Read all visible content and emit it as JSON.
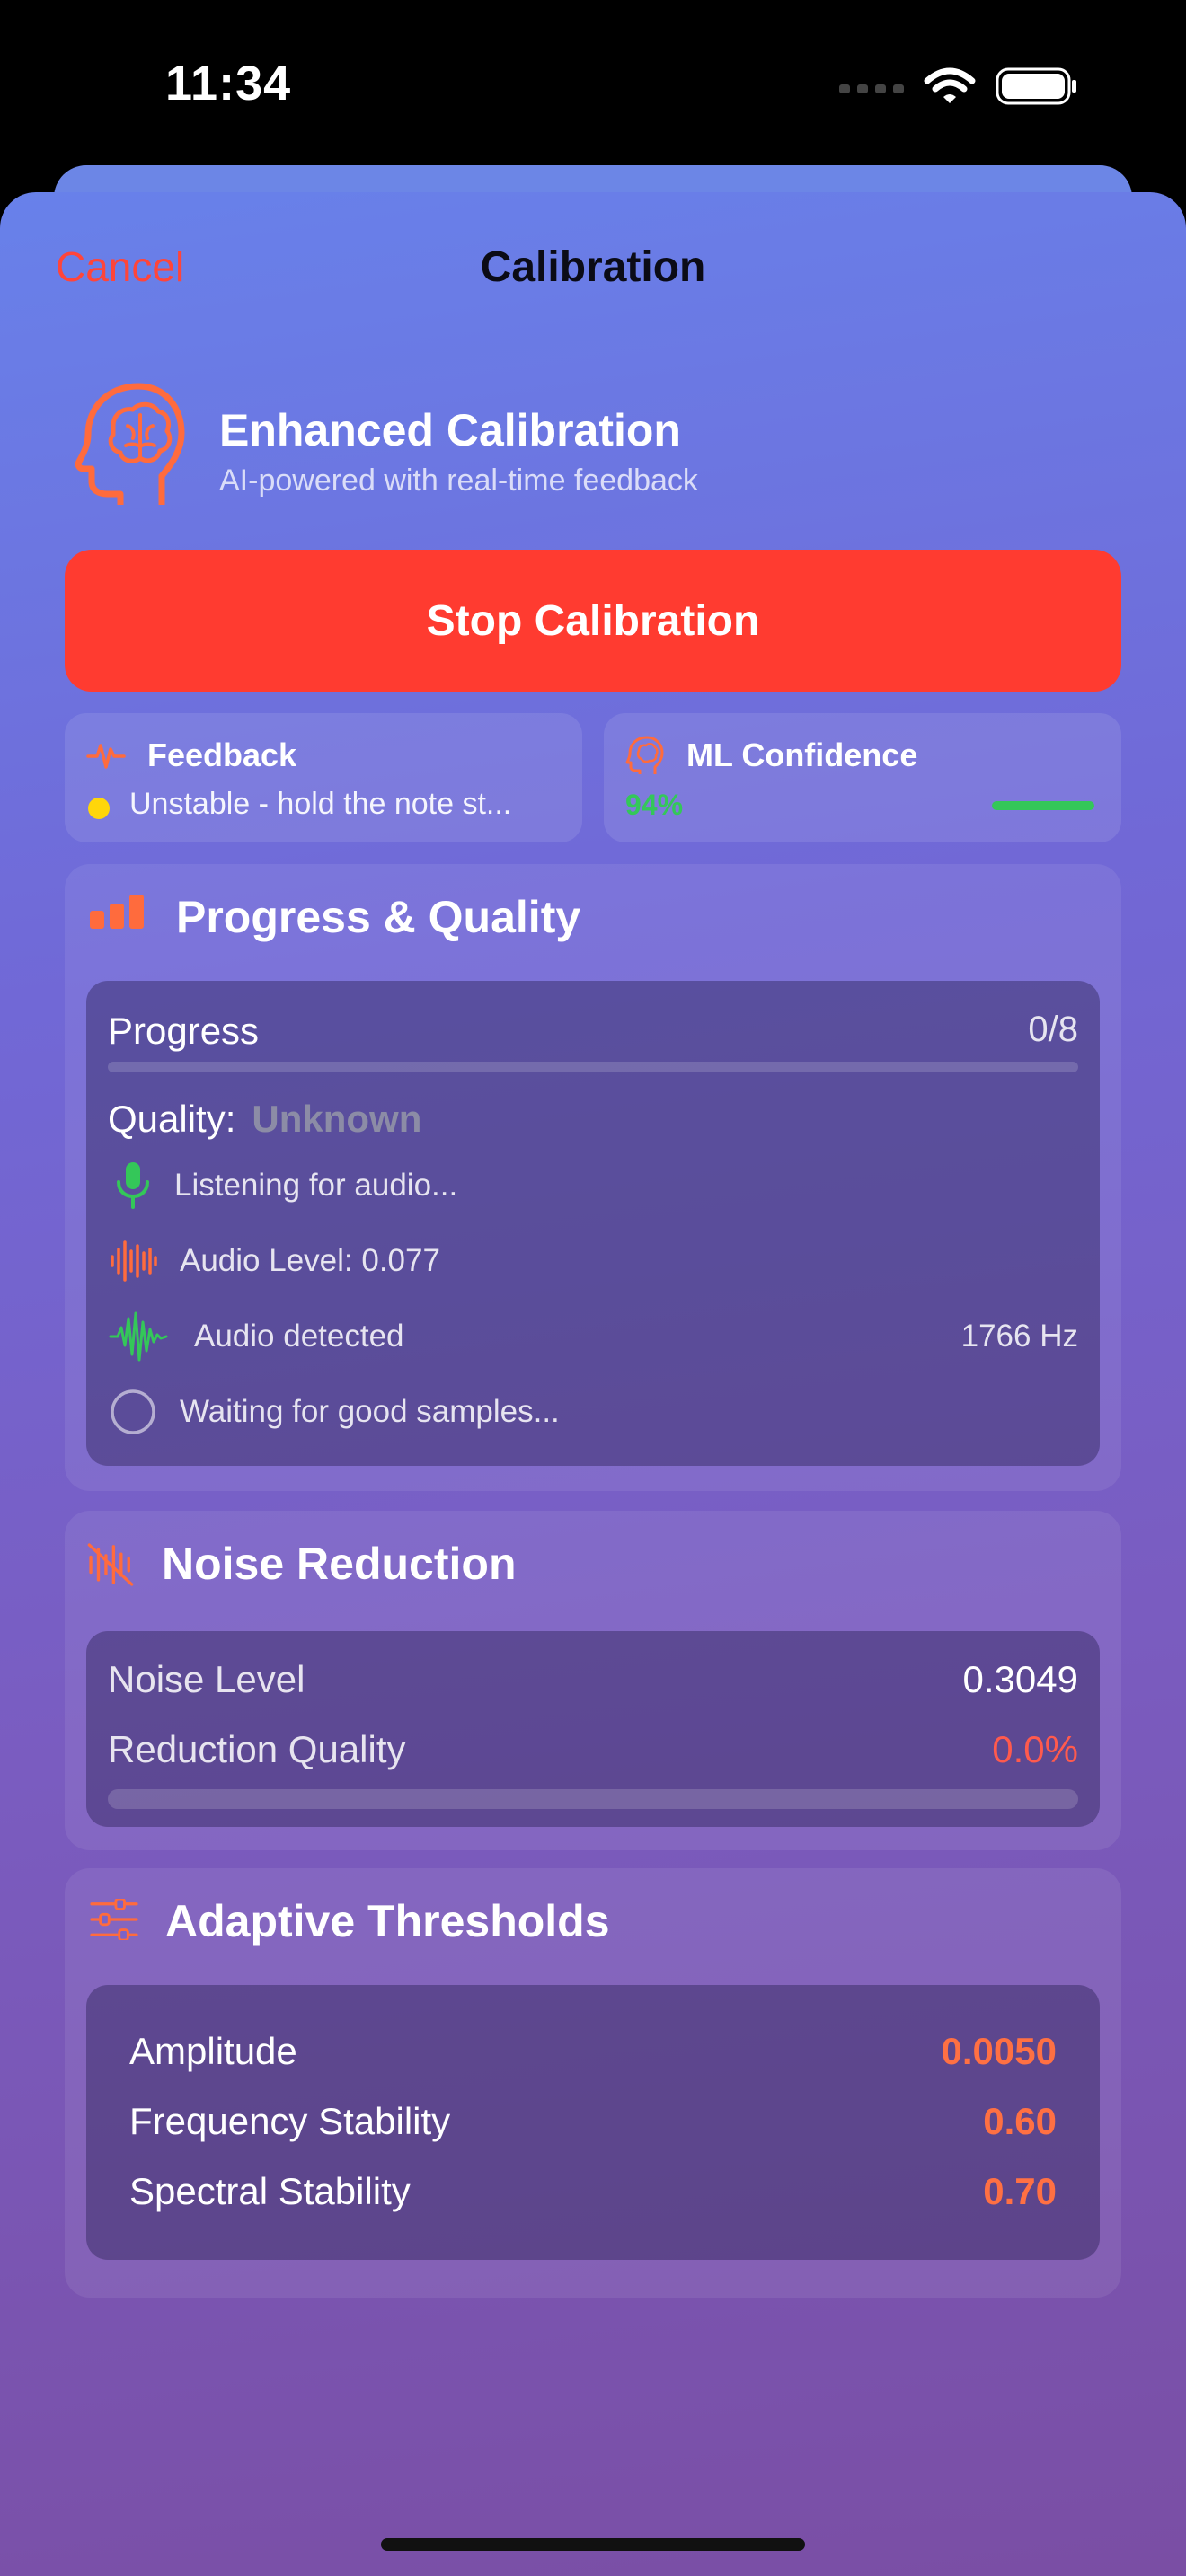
{
  "status_bar": {
    "time": "11:34"
  },
  "nav": {
    "cancel_label": "Cancel",
    "title": "Calibration"
  },
  "hero": {
    "icon": "brain-head-icon",
    "title": "Enhanced Calibration",
    "subtitle": "AI-powered with real-time feedback"
  },
  "stop_button": {
    "label": "Stop Calibration"
  },
  "feedback": {
    "icon": "waveform-pulse-icon",
    "title": "Feedback",
    "message": "Unstable - hold the note st..."
  },
  "ml_confidence": {
    "icon": "brain-head-icon",
    "title": "ML Confidence",
    "value": "94%",
    "level": 0.94
  },
  "progress_section": {
    "icon": "chart-bar-icon",
    "title": "Progress & Quality",
    "progress_label": "Progress",
    "progress_count": "0/8",
    "progress_fraction": 0,
    "quality_label": "Quality:",
    "quality_value": "Unknown",
    "rows": [
      {
        "icon": "mic-icon",
        "text": "Listening for audio...",
        "right": ""
      },
      {
        "icon": "waveform-icon",
        "text": "Audio Level: 0.077",
        "right": ""
      },
      {
        "icon": "waveform-path-icon",
        "text": "Audio detected",
        "right": "1766 Hz"
      },
      {
        "icon": "circle-icon",
        "text": "Waiting for good samples...",
        "right": ""
      }
    ]
  },
  "noise_section": {
    "icon": "waveform-slash-icon",
    "title": "Noise Reduction",
    "noise_level_label": "Noise Level",
    "noise_level_value": "0.3049",
    "reduction_label": "Reduction Quality",
    "reduction_value": "0.0%",
    "reduction_fraction": 0
  },
  "adaptive_section": {
    "icon": "sliders-icon",
    "title": "Adaptive Thresholds",
    "items": [
      {
        "label": "Amplitude",
        "value": "0.0050"
      },
      {
        "label": "Frequency Stability",
        "value": "0.60"
      },
      {
        "label": "Spectral Stability",
        "value": "0.70"
      }
    ]
  },
  "colors": {
    "accent": "#ff6b3d",
    "stop": "#ff3b30",
    "success": "#34c759",
    "warning": "#ffd60a",
    "cancel": "#ff453a"
  }
}
